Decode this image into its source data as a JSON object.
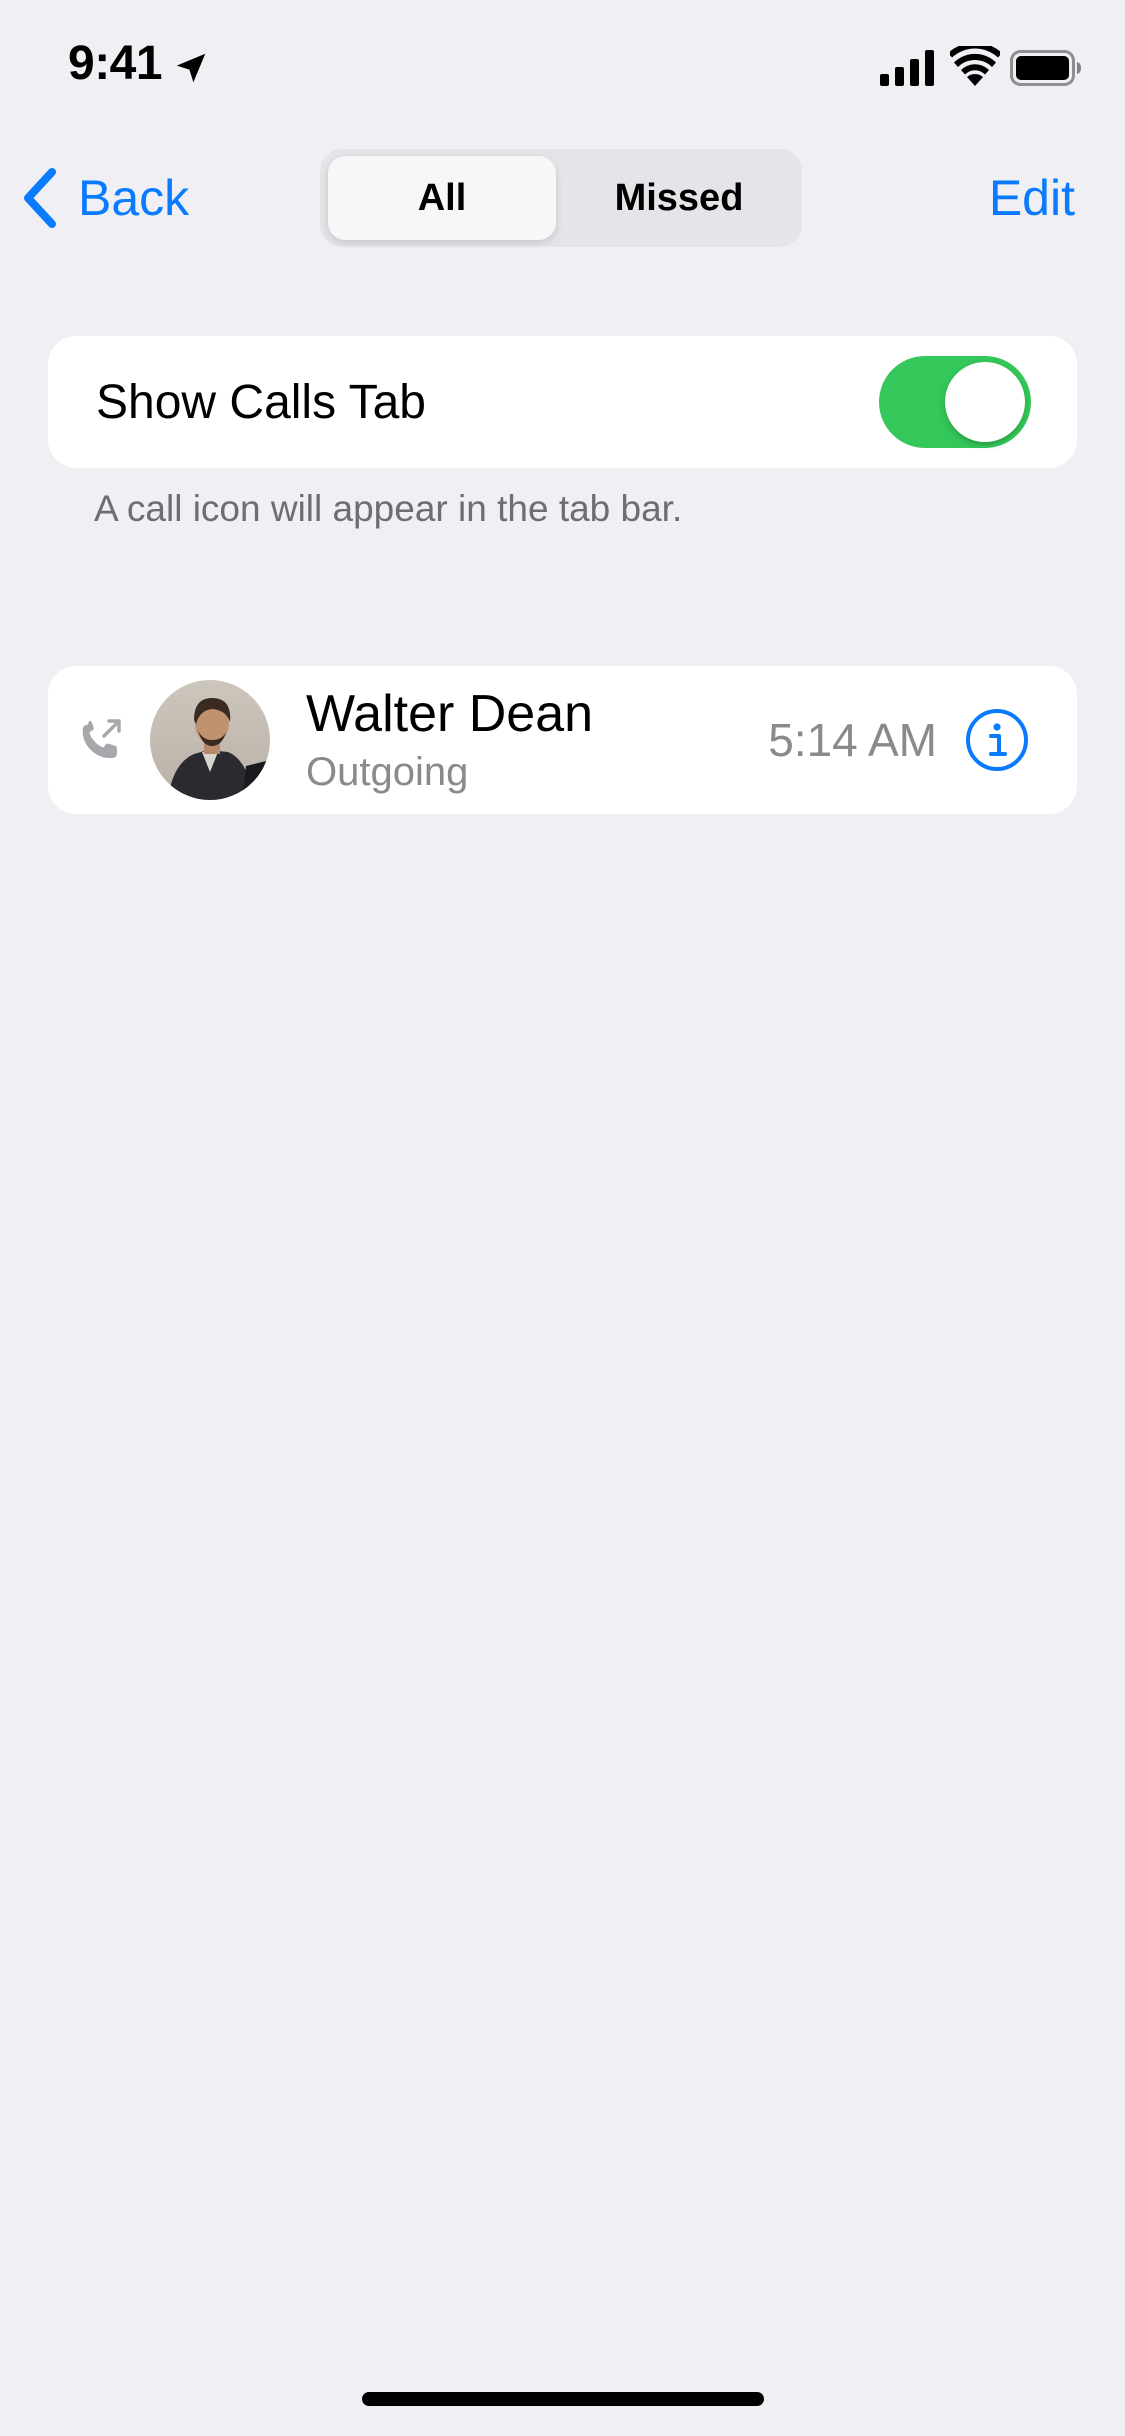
{
  "status_bar": {
    "time": "9:41",
    "icons": [
      "location-arrow-icon",
      "cellular-signal-icon",
      "wifi-icon",
      "battery-icon"
    ]
  },
  "nav": {
    "back_label": "Back",
    "segments": [
      {
        "label": "All",
        "selected": true
      },
      {
        "label": "Missed",
        "selected": false
      }
    ],
    "edit_label": "Edit"
  },
  "settings": {
    "show_calls_tab_label": "Show Calls Tab",
    "show_calls_tab_enabled": true,
    "footnote": "A call icon will appear in the tab bar."
  },
  "calls": [
    {
      "name": "Walter Dean",
      "type": "Outgoing",
      "time": "5:14 AM",
      "direction_icon": "outgoing-call-icon",
      "info_icon": "info-icon"
    }
  ],
  "colors": {
    "accent": "#0a7aff",
    "toggle_on": "#34c759",
    "background": "#efeff4",
    "secondary_text": "#8a8a8e"
  }
}
